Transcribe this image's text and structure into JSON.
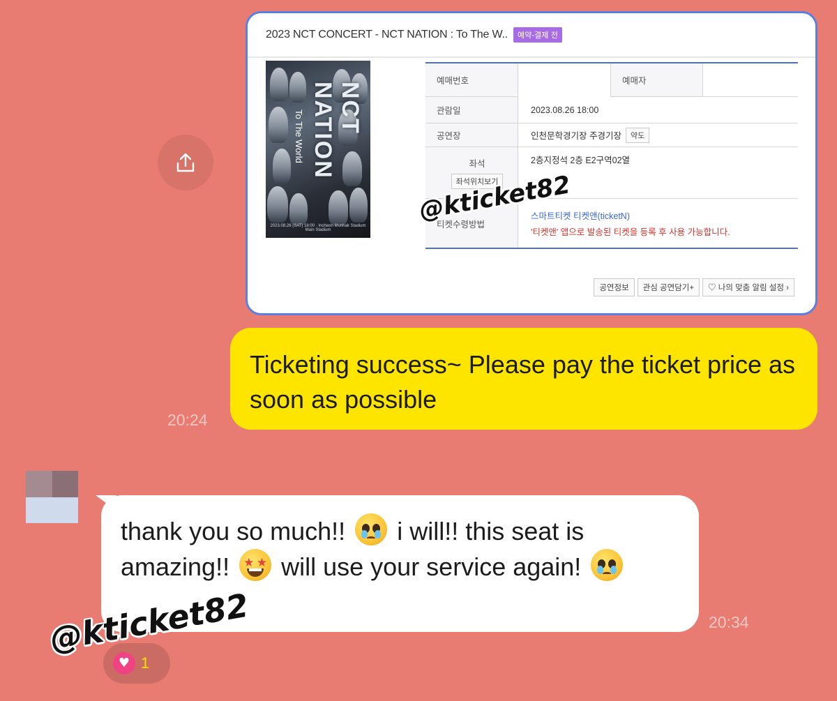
{
  "ticket": {
    "title": "2023 NCT CONCERT - NCT NATION : To The W..",
    "badge": "예약-결제 전",
    "poster": {
      "main_text": "NCT NATION",
      "sub_text": "To The World",
      "footer": "2023.08.26 (SAT) 18:00 · Incheon Munhak Stadium Main Stadium"
    },
    "rows": {
      "booking_no_label": "예매번호",
      "booker_label": "예매자",
      "date_label": "관람일",
      "date_value": "2023.08.26 18:00",
      "venue_label": "공연장",
      "venue_value": "인천문학경기장 주경기장",
      "map_button": "약도",
      "seat_label": "좌석",
      "seat_view_button": "좌석위치보기",
      "seat_value": "2층지정석 2층 E2구역02열",
      "receive_label": "티켓수령방법",
      "receive_link": "스마트티켓 티켓앤(ticketN)",
      "receive_note": "'티켓앤' 앱으로 발송된 티켓을 등록 후 사용 가능합니다."
    },
    "buttons": {
      "info": "공연정보",
      "wishlist": "관심 공연담기+",
      "alert": "♡ 나의 맞춤 알림 설정 ›"
    }
  },
  "watermark": "@kticket82",
  "messages": {
    "outgoing": {
      "text": "Ticketing success~ Please pay the ticket price as soon as possible",
      "time": "20:24"
    },
    "incoming": {
      "part1": "thank you so much!!",
      "part2": "i will!! this seat is amazing!!",
      "part3": "will use your service again!",
      "time": "20:34"
    }
  },
  "reaction": {
    "icon": "heart-icon",
    "count": "1"
  },
  "colors": {
    "background": "#e87c72",
    "outgoing_bubble": "#fee500",
    "incoming_bubble": "#ffffff",
    "reaction_heart": "#f04384"
  }
}
